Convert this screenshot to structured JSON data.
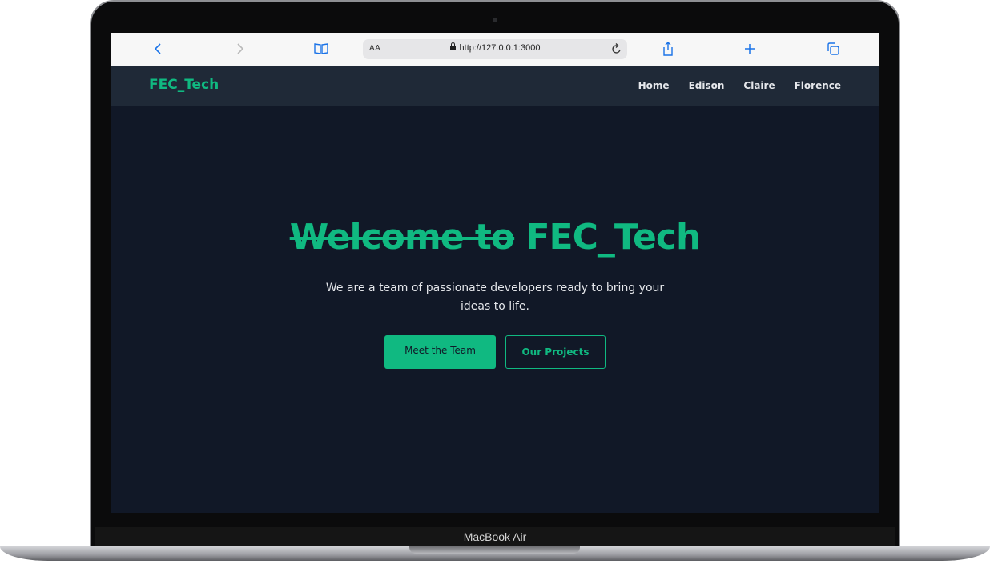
{
  "browser": {
    "reader_label": "AA",
    "url": "http://127.0.0.1:3000",
    "icons": [
      "back-icon",
      "forward-icon",
      "bookmarks-icon",
      "lock-icon",
      "reload-icon",
      "share-icon",
      "new-tab-icon",
      "tabs-icon"
    ]
  },
  "site": {
    "brand": "FEC_Tech",
    "nav": [
      "Home",
      "Edison",
      "Claire",
      "Florence"
    ],
    "hero": {
      "title_struck": "Welcome to",
      "title_rest": "FEC_Tech",
      "subtitle": "We are a team of passionate developers ready to bring your ideas to life.",
      "primary_button": "Meet the Team",
      "secondary_button": "Our Projects"
    }
  },
  "device": {
    "label": "MacBook Air"
  },
  "colors": {
    "accent": "#10b981",
    "background": "#111827",
    "nav_background": "#1f2937",
    "text": "#e5e7eb"
  }
}
